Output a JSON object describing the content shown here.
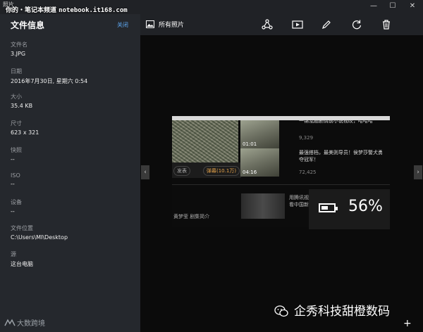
{
  "window": {
    "title": "照片",
    "minimize_glyph": "—",
    "maximize_glyph": "☐",
    "close_glyph": "✕"
  },
  "watermark_top": {
    "site": "你的・笔记本频道",
    "url": "notebook.it168.com"
  },
  "info_panel": {
    "title": "文件信息",
    "close_label": "关闭",
    "fields": [
      {
        "label": "文件名",
        "value": "3.JPG"
      },
      {
        "label": "日期",
        "value": "2016年7月30日, 星期六 0:54"
      },
      {
        "label": "大小",
        "value": "35.4 KB"
      },
      {
        "label": "尺寸",
        "value": "623 x 321"
      },
      {
        "label": "快照",
        "value": "--"
      },
      {
        "label": "ISO",
        "value": "--"
      },
      {
        "label": "设备",
        "value": "--"
      },
      {
        "label": "文件位置",
        "value": "C:\\Users\\MI\\Desktop"
      },
      {
        "label": "源",
        "value": "这台电脑"
      }
    ]
  },
  "toolbar": {
    "all_photos_label": "所有照片",
    "icons": [
      "share-icon",
      "slideshow-icon",
      "edit-icon",
      "rotate-icon",
      "delete-icon"
    ]
  },
  "photo": {
    "tags": [
      "发表",
      "弹幕(10.1万)"
    ],
    "videos": [
      {
        "duration": "01:01",
        "title": "一锦泓题剧情前小说视叹，哈哈哈",
        "meta": "9,329"
      },
      {
        "duration": "04:16",
        "title": "最强搭档，最美则导员！侯梦莎警犬勇夺冠军！",
        "meta": "72,425"
      }
    ],
    "ad_text": [
      "用腾讯视频",
      "看中国新闻"
    ],
    "cast_line": "黄梦莹  剧集简介"
  },
  "battery": {
    "percent_text": "56%",
    "level": 0.56
  },
  "watermark_bottom_right": "企秀科技甜橙数码",
  "watermark_bottom_left": "大数跨境"
}
